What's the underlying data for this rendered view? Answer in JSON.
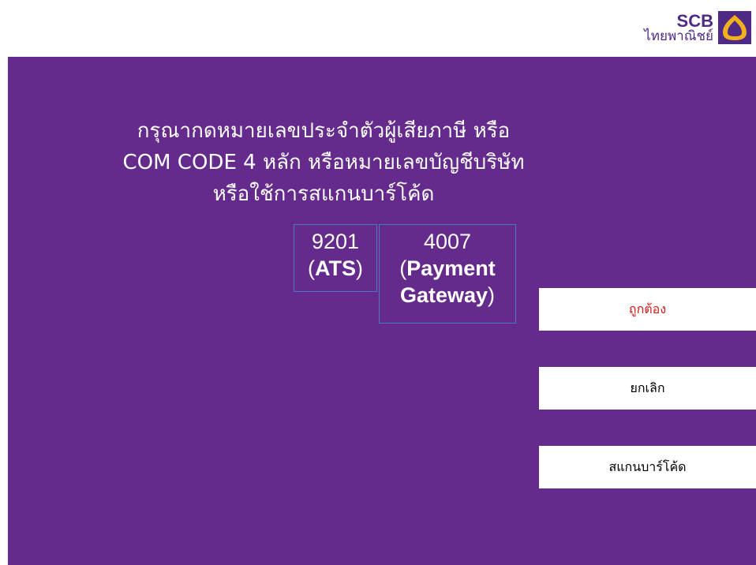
{
  "brand": {
    "name": "SCB",
    "thai_name": "ไทยพาณิชย์",
    "accent_color": "#642a8c",
    "logo_color": "#f2b01e"
  },
  "instruction": {
    "line1": "กรุณากดหมายเลขประจำตัวผู้เสียภาษี หรือ",
    "line2": "COM CODE 4 หลัก หรือหมายเลขบัญชีบริษัท",
    "line3": "หรือใช้การสแกนบาร์โค้ด"
  },
  "codes": [
    {
      "number": "9201",
      "open": "(",
      "name": "ATS",
      "close": ")"
    },
    {
      "number": "4007",
      "open": "(",
      "name_line1": "Payment",
      "name_line2": "Gateway",
      "close": ")"
    }
  ],
  "buttons": {
    "confirm": {
      "label": "ถูกต้อง",
      "color": "#d21a1a"
    },
    "cancel": {
      "label": "ยกเลิก",
      "color": "#000000"
    },
    "scan": {
      "label": "สแกนบาร์โค้ด",
      "color": "#000000"
    }
  }
}
